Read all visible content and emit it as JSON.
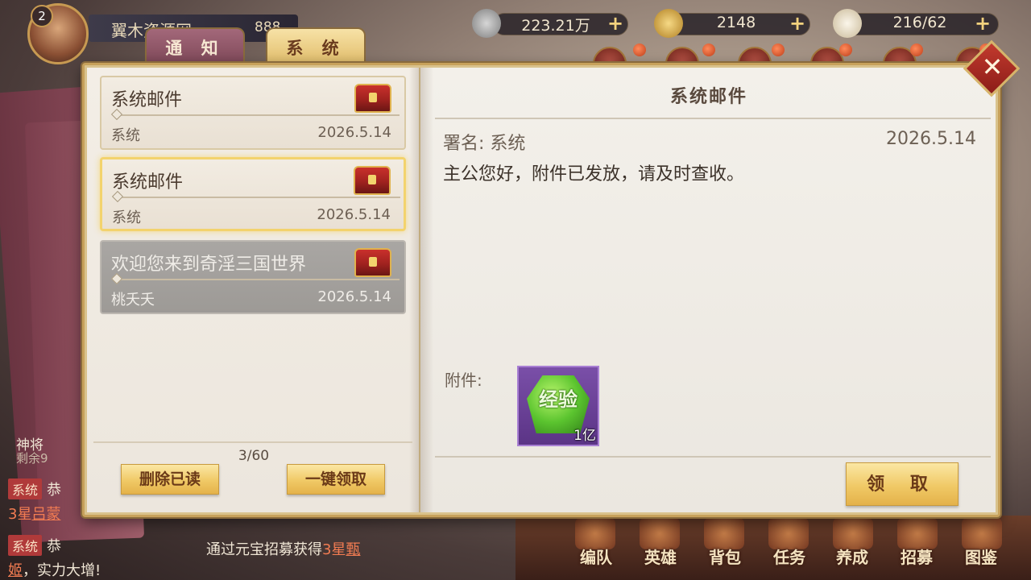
{
  "player": {
    "level": "2",
    "name": "翼木资源网",
    "power": "888"
  },
  "resources": [
    {
      "icon": "coin-icon",
      "value": "223.21万"
    },
    {
      "icon": "gold-ingot-icon",
      "value": "2148"
    },
    {
      "icon": "stamina-bun-icon",
      "value": "216/62"
    }
  ],
  "tabs": {
    "notice": "通 知",
    "system": "系 统"
  },
  "mail_list": [
    {
      "title": "系统邮件",
      "sender": "系统",
      "date": "2026.5.14"
    },
    {
      "title": "系统邮件",
      "sender": "系统",
      "date": "2026.5.14"
    },
    {
      "title": "欢迎您来到奇淫三国世界",
      "sender": "桃夭夭",
      "date": "2026.5.14"
    }
  ],
  "page_count": "3/60",
  "buttons": {
    "delete_read": "删除已读",
    "claim_all": "一键领取",
    "claim": "领 取"
  },
  "detail": {
    "title": "系统邮件",
    "signature": "署名: 系统",
    "date": "2026.5.14",
    "body": "主公您好，附件已发放，请及时查收。",
    "attachment_label": "附件:",
    "attachment": {
      "name": "经验",
      "quantity": "1亿"
    }
  },
  "chat": {
    "side_label": "神将",
    "side_sub": "剩余9",
    "tag": "系统",
    "line1_pre": "恭",
    "line2_pre": "3星",
    "line2_hl": "吕蒙",
    "line3_mid": "通过元宝招募获得",
    "line3_star": "3星",
    "line3_hl": "甄",
    "line4_hl": "姬",
    "line4_rest": "，实力大增!"
  },
  "bottom_nav": [
    "编队",
    "英雄",
    "背包",
    "任务",
    "养成",
    "招募",
    "图鉴"
  ]
}
